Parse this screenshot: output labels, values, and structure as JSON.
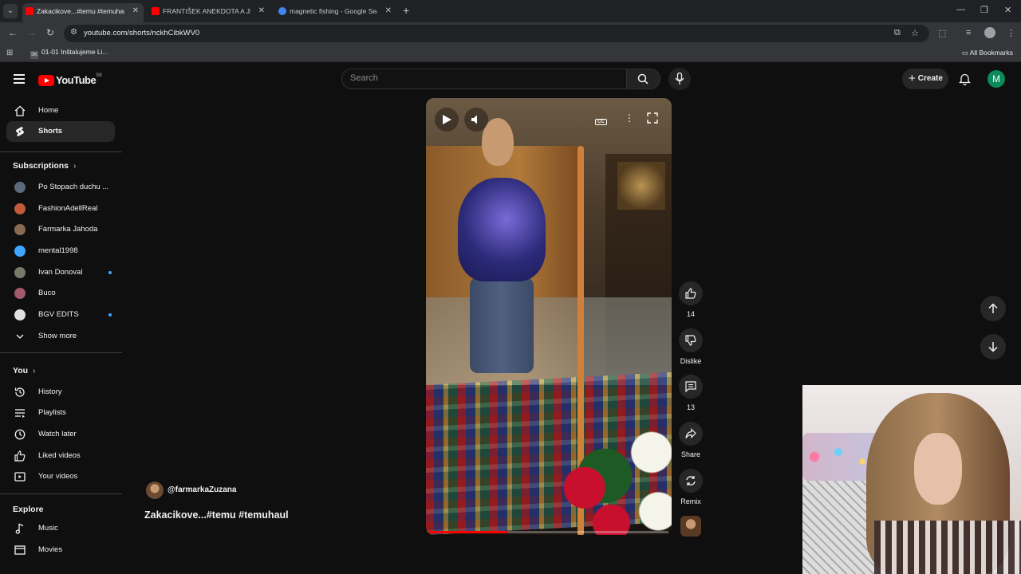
{
  "browser": {
    "tabs": [
      {
        "label": "Zakacikove...#temu #temuhaul",
        "active": true
      },
      {
        "label": "FRANTIŠEK ANEKDOTA A JEHO",
        "active": false
      },
      {
        "label": "magnetic fishing - Google Sear",
        "active": false
      }
    ],
    "url": "youtube.com/shorts/nckhCibkWV0",
    "bookmarks": [
      {
        "label": "01-01 Inštalujeme Li..."
      }
    ],
    "all_bookmarks": "All Bookmarks"
  },
  "header": {
    "logo_text": "YouTube",
    "logo_country": "SK",
    "search_placeholder": "Search",
    "create_label": "Create",
    "avatar_letter": "M"
  },
  "sidebar": {
    "main": [
      {
        "label": "Home",
        "icon": "home-icon"
      },
      {
        "label": "Shorts",
        "icon": "shorts-icon",
        "active": true
      }
    ],
    "subscriptions_title": "Subscriptions",
    "subscriptions": [
      {
        "label": "Po Stopach duchu ...",
        "color": "#5a6a7a",
        "live": false
      },
      {
        "label": "FashionAdellReal",
        "color": "#c05a3a",
        "live": false
      },
      {
        "label": "Farmarka Jahoda",
        "color": "#8a6a50",
        "live": false
      },
      {
        "label": "mental1998",
        "color": "#3ea6ff",
        "live": false
      },
      {
        "label": "Ivan Donoval",
        "color": "#7a7a6a",
        "live": true
      },
      {
        "label": "Buco",
        "color": "#a05a6a",
        "live": false
      },
      {
        "label": "BGV EDITS",
        "color": "#e0e0e0",
        "live": true
      }
    ],
    "show_more": "Show more",
    "you_title": "You",
    "you_items": [
      {
        "label": "History",
        "icon": "history-icon"
      },
      {
        "label": "Playlists",
        "icon": "playlists-icon"
      },
      {
        "label": "Watch later",
        "icon": "clock-icon"
      },
      {
        "label": "Liked videos",
        "icon": "thumbs-up-icon"
      },
      {
        "label": "Your videos",
        "icon": "video-icon"
      }
    ],
    "explore_title": "Explore",
    "explore_items": [
      {
        "label": "Music",
        "icon": "music-icon"
      },
      {
        "label": "Movies",
        "icon": "movies-icon"
      }
    ]
  },
  "short": {
    "channel": "@farmarkaZuzana",
    "title": "Zakacikove...#temu #temuhaul",
    "progress": 0.33,
    "actions": {
      "like_count": "14",
      "dislike_label": "Dislike",
      "comment_count": "13",
      "share_label": "Share",
      "remix_label": "Remix"
    }
  }
}
